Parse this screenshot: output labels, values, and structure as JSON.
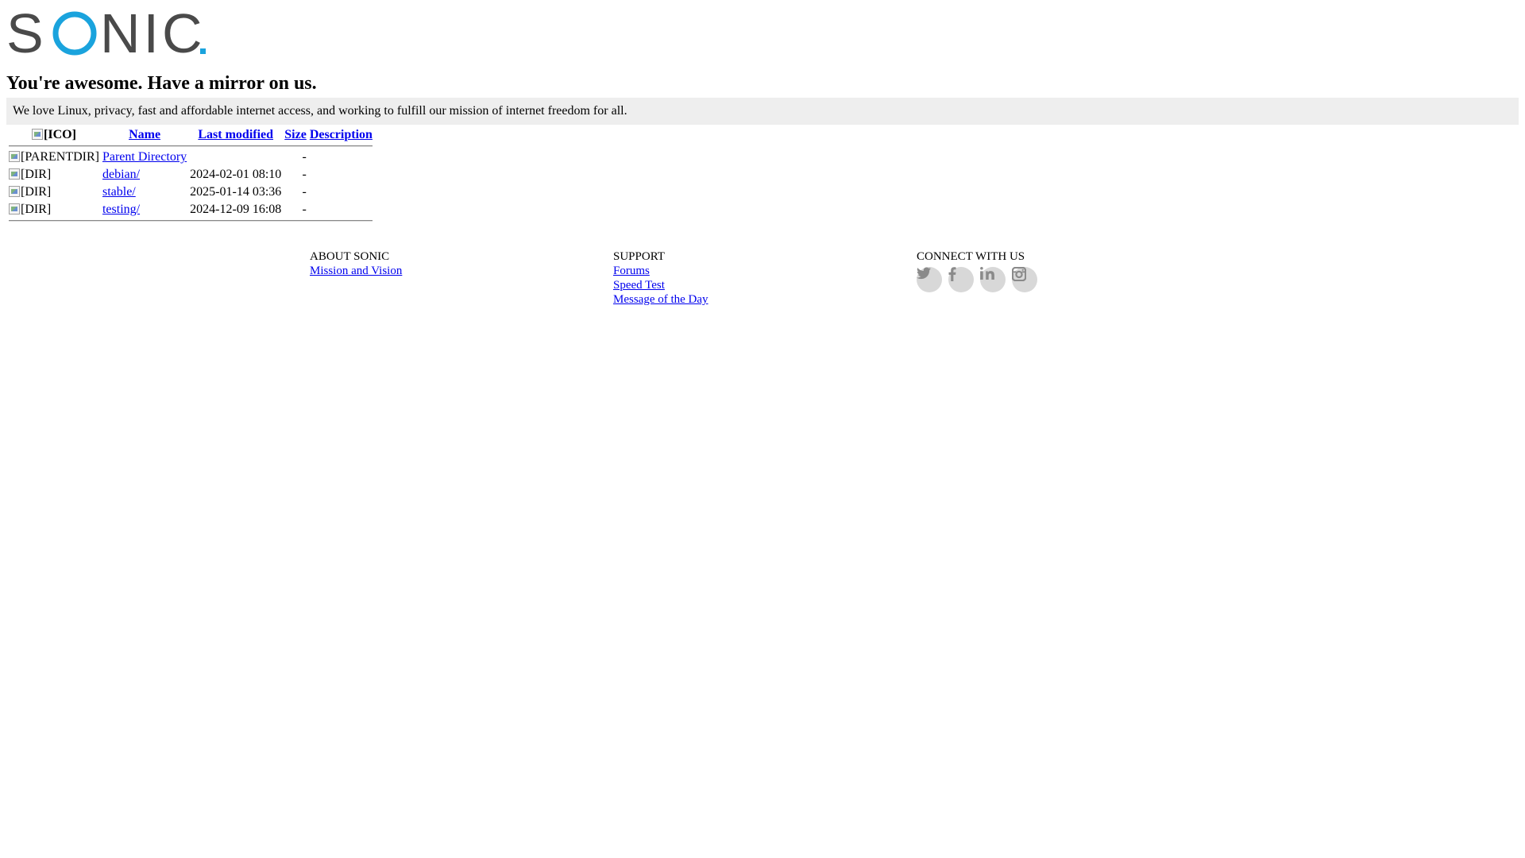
{
  "brand": {
    "logo_text": "SONIC",
    "colors": {
      "gray": "#4a4a4a",
      "blue": "#1aa3dd"
    }
  },
  "tagline": "You're awesome. Have a mirror on us.",
  "mission": "We love Linux, privacy, fast and affordable internet access, and working to fulfill our mission of internet freedom for all.",
  "listing": {
    "headers": {
      "icon": "[ICO]",
      "name": "Name",
      "last_modified": "Last modified",
      "size": "Size",
      "description": "Description"
    },
    "rows": [
      {
        "icon_alt": "[PARENTDIR]",
        "name": "Parent Directory",
        "last_modified": "",
        "size": "-",
        "description": ""
      },
      {
        "icon_alt": "[DIR]",
        "name": "debian/",
        "last_modified": "2024-02-01 08:10",
        "size": "-",
        "description": ""
      },
      {
        "icon_alt": "[DIR]",
        "name": "stable/",
        "last_modified": "2025-01-14 03:36",
        "size": "-",
        "description": ""
      },
      {
        "icon_alt": "[DIR]",
        "name": "testing/",
        "last_modified": "2024-12-09 16:08",
        "size": "-",
        "description": ""
      }
    ]
  },
  "footer": {
    "about": {
      "heading": "ABOUT SONIC",
      "links": [
        "Mission and Vision"
      ]
    },
    "support": {
      "heading": "SUPPORT",
      "links": [
        "Forums",
        "Speed Test",
        "Message of the Day"
      ]
    },
    "connect": {
      "heading": "CONNECT WITH US",
      "icons": [
        "twitter-icon",
        "facebook-icon",
        "linkedin-icon",
        "instagram-icon"
      ],
      "icon_color": "#8a8a8a"
    }
  }
}
